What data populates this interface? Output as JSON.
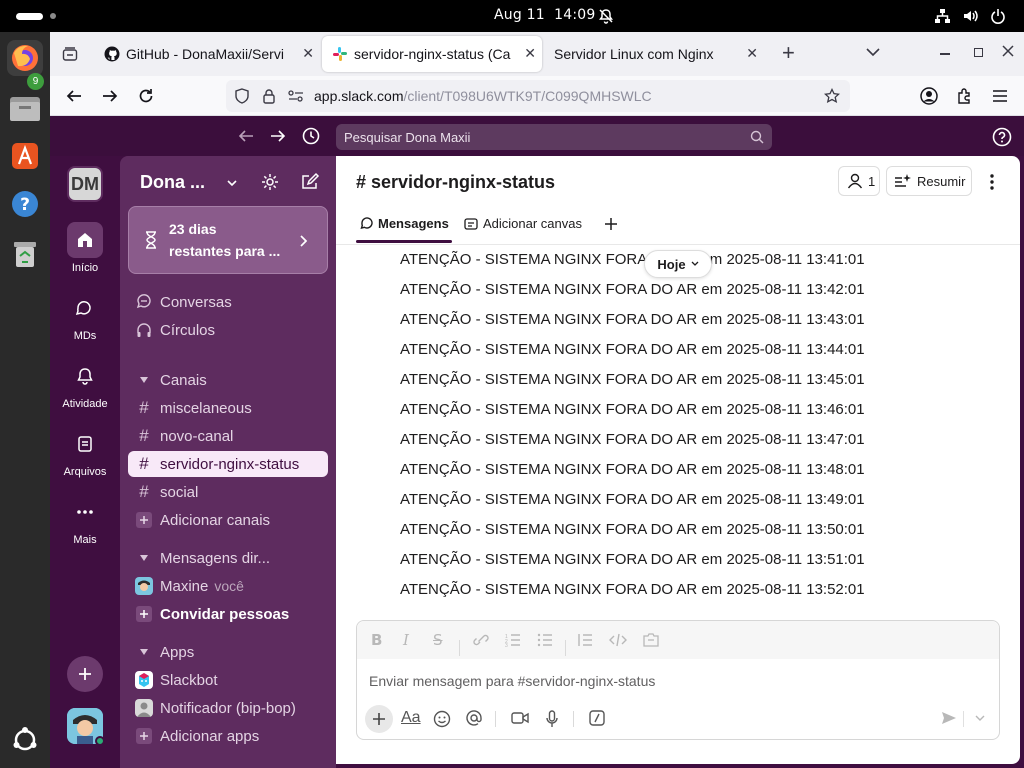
{
  "system": {
    "date": "Aug 11",
    "time": "14:09"
  },
  "dock": {
    "firefox_badge": "9",
    "apps": [
      "firefox-icon",
      "files-icon",
      "app-center-icon",
      "help-icon",
      "trash-icon",
      "ubuntu-apps-icon"
    ]
  },
  "browser": {
    "tabs": [
      {
        "title": "GitHub - DonaMaxii/Servi",
        "favicon": "github-icon"
      },
      {
        "title": "servidor-nginx-status (Ca",
        "favicon": "slack-icon"
      },
      {
        "title": "Servidor Linux com Nginx",
        "favicon": "none"
      }
    ],
    "close_glyph": "✕",
    "new_tab_glyph": "+",
    "url_host": "app.slack.com",
    "url_path": "/client/T098U6WTK9T/C099QMHSWLC"
  },
  "slack": {
    "search_placeholder": "Pesquisar Dona Maxii",
    "workspace_initials": "DM",
    "workspace_name": "Dona ...",
    "rail": {
      "home": "Início",
      "dms": "MDs",
      "activity": "Atividade",
      "files": "Arquivos",
      "more": "Mais"
    },
    "trial": {
      "line1": "23 dias",
      "line2": "restantes para ..."
    },
    "sidebar": {
      "conversations": "Conversas",
      "circles": "Círculos",
      "channels_header": "Canais",
      "channels": [
        "miscelaneous",
        "novo-canal",
        "servidor-nginx-status",
        "social"
      ],
      "add_channels": "Adicionar canais",
      "dm_header": "Mensagens dir...",
      "dm_user": "Maxine",
      "dm_you": "você",
      "invite": "Convidar pessoas",
      "apps_header": "Apps",
      "apps": [
        "Slackbot",
        "Notificador (bip-bop)"
      ],
      "add_apps": "Adicionar apps"
    },
    "channel": {
      "name": "# servidor-nginx-status",
      "members_count": "1",
      "summarize": "Resumir",
      "tabs": [
        "Mensagens",
        "Adicionar canvas"
      ],
      "today_label": "Hoje"
    },
    "messages": [
      "ATENÇÃO - SISTEMA NGINX FORA DO AR em 2025-08-11 13:41:01",
      "ATENÇÃO - SISTEMA NGINX FORA DO AR em 2025-08-11 13:42:01",
      "ATENÇÃO - SISTEMA NGINX FORA DO AR em 2025-08-11 13:43:01",
      "ATENÇÃO - SISTEMA NGINX FORA DO AR em 2025-08-11 13:44:01",
      "ATENÇÃO - SISTEMA NGINX FORA DO AR em 2025-08-11 13:45:01",
      "ATENÇÃO - SISTEMA NGINX FORA DO AR em 2025-08-11 13:46:01",
      "ATENÇÃO - SISTEMA NGINX FORA DO AR em 2025-08-11 13:47:01",
      "ATENÇÃO - SISTEMA NGINX FORA DO AR em 2025-08-11 13:48:01",
      "ATENÇÃO - SISTEMA NGINX FORA DO AR em 2025-08-11 13:49:01",
      "ATENÇÃO - SISTEMA NGINX FORA DO AR em 2025-08-11 13:50:01",
      "ATENÇÃO - SISTEMA NGINX FORA DO AR em 2025-08-11 13:51:01",
      "ATENÇÃO - SISTEMA NGINX FORA DO AR em 2025-08-11 13:52:01"
    ],
    "composer": {
      "placeholder": "Enviar mensagem para #servidor-nginx-status",
      "format_label": "Aa"
    }
  },
  "colors": {
    "slack_aubergine": "#3f0e40",
    "sidebar": "#5e2c5f",
    "selected_channel": "#f8e9f8",
    "online": "#2bac76"
  }
}
